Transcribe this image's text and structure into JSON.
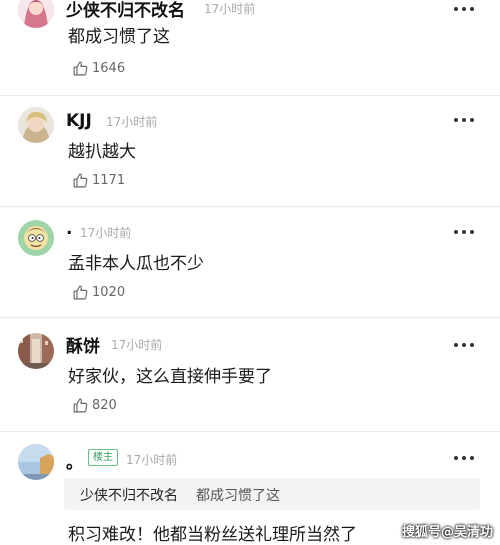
{
  "comments": [
    {
      "name": "少侠不归不改名",
      "time": "17小时前",
      "text": "都成习惯了这",
      "likes": "1646",
      "avatar": "avatar-girl-pink-hair"
    },
    {
      "name": "KJJ",
      "time": "17小时前",
      "text": "越扒越大",
      "likes": "1171",
      "avatar": "avatar-man-blond"
    },
    {
      "name": ".",
      "time": "17小时前",
      "text": "孟非本人瓜也不少",
      "likes": "1020",
      "avatar": "avatar-cartoon-morty"
    },
    {
      "name": "酥饼",
      "time": "17小时前",
      "text": "好家伙，这么直接伸手要了",
      "likes": "820",
      "avatar": "avatar-city-street"
    },
    {
      "name": "。",
      "badge": "楼主",
      "time": "17小时前",
      "quote": {
        "name": "少侠不归不改名",
        "text": "都成习惯了这"
      },
      "text": "积习难改！他都当粉丝送礼理所当然了",
      "avatar": "avatar-sky-building"
    }
  ],
  "watermark": "搜狐号@吴清功",
  "colors": {
    "badge_border": "#67c08a",
    "time": "#a8a8a8",
    "quote_bg": "#f3f3f3"
  }
}
